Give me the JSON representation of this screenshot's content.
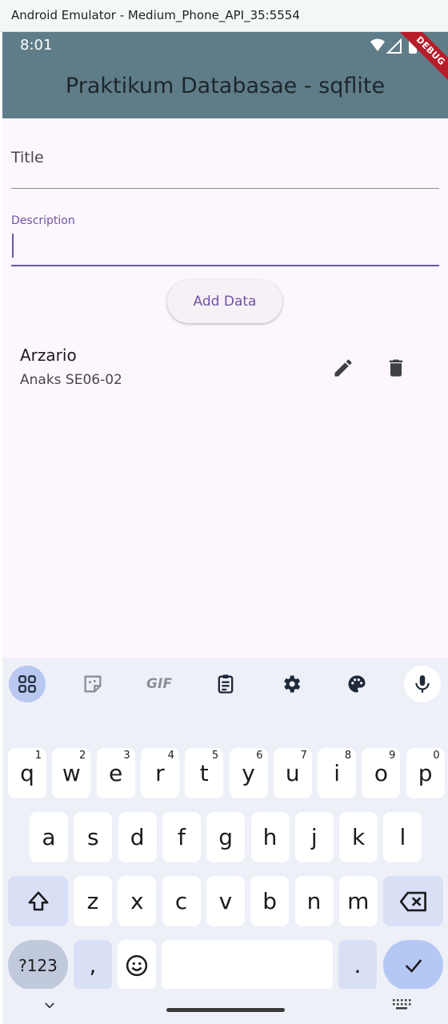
{
  "window": {
    "title": "Android Emulator - Medium_Phone_API_35:5554"
  },
  "status": {
    "time": "8:01",
    "debug": "DEBUG"
  },
  "appbar": {
    "title": "Praktikum Databasae - sqflite"
  },
  "form": {
    "title_hint": "Title",
    "description_label": "Description",
    "description_value": "",
    "add_button": "Add Data"
  },
  "list": {
    "items": [
      {
        "title": "Arzario",
        "subtitle": "Anaks SE06-02"
      }
    ]
  },
  "keyboard": {
    "row1": [
      {
        "key": "q",
        "hint": "1"
      },
      {
        "key": "w",
        "hint": "2"
      },
      {
        "key": "e",
        "hint": "3"
      },
      {
        "key": "r",
        "hint": "4"
      },
      {
        "key": "t",
        "hint": "5"
      },
      {
        "key": "y",
        "hint": "6"
      },
      {
        "key": "u",
        "hint": "7"
      },
      {
        "key": "i",
        "hint": "8"
      },
      {
        "key": "o",
        "hint": "9"
      },
      {
        "key": "p",
        "hint": "0"
      }
    ],
    "row2": [
      "a",
      "s",
      "d",
      "f",
      "g",
      "h",
      "j",
      "k",
      "l"
    ],
    "row3": [
      "z",
      "x",
      "c",
      "v",
      "b",
      "n",
      "m"
    ],
    "symbols": "?123",
    "comma": ",",
    "period": ".",
    "gif": "GIF"
  },
  "colors": {
    "appbar": "#5f7d89",
    "accent": "#6d55a4",
    "background": "#fdf6fd"
  }
}
